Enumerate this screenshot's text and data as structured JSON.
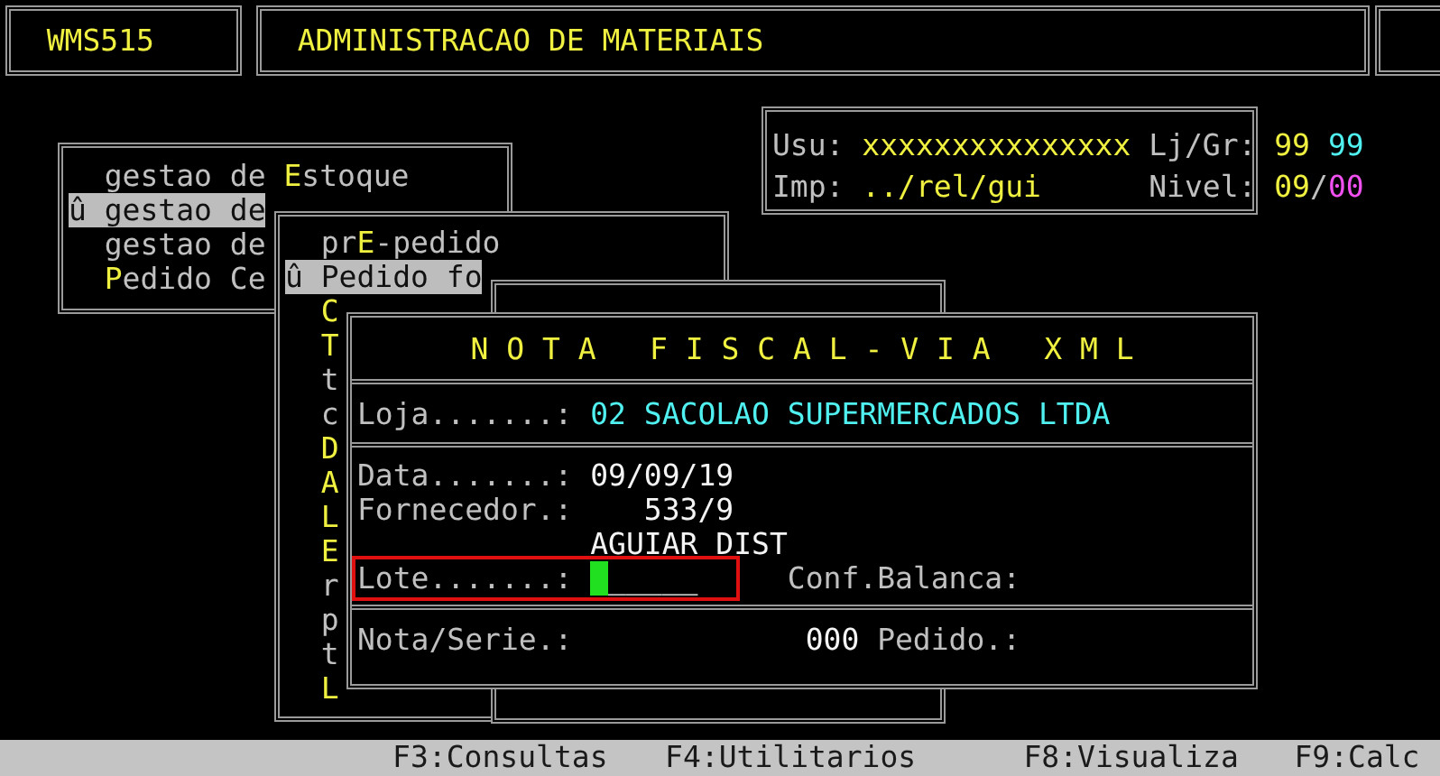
{
  "header": {
    "program_code": "WMS515",
    "title": "ADMINISTRACAO DE MATERIAIS"
  },
  "user_info": {
    "usu_label": "Usu:",
    "usu_value": "xxxxxxxxxxxxxxx",
    "lj_label": "Lj/Gr:",
    "loja": "99",
    "grupo": "99",
    "imp_label": "Imp:",
    "imp_value": "../rel/gui",
    "nivel_label": "Nivel:",
    "nivel": "09",
    "nivel_separator": "/",
    "nivel_sub": "00"
  },
  "main_menu": {
    "items": [
      {
        "selected": false,
        "parts": [
          {
            "text": "gestao de ",
            "hotkey": false
          },
          {
            "text": "E",
            "hotkey": true
          },
          {
            "text": "stoque",
            "hotkey": false
          }
        ]
      },
      {
        "selected": true,
        "marker": "û",
        "parts": [
          {
            "text": "gestao de",
            "hotkey": false
          }
        ]
      },
      {
        "selected": false,
        "parts": [
          {
            "text": "gestao de",
            "hotkey": false
          }
        ]
      },
      {
        "selected": false,
        "parts": [
          {
            "text": "P",
            "hotkey": true
          },
          {
            "text": "edido Ce",
            "hotkey": false
          }
        ]
      }
    ]
  },
  "sub_menu": {
    "items": [
      {
        "selected": false,
        "parts": [
          {
            "text": "pr",
            "hotkey": false
          },
          {
            "text": "E",
            "hotkey": true
          },
          {
            "text": "-pedido",
            "hotkey": false
          }
        ]
      },
      {
        "selected": true,
        "marker": "û",
        "parts": [
          {
            "text": "Pedido fo",
            "hotkey": false
          }
        ]
      },
      {
        "selected": false,
        "parts": [
          {
            "text": "C",
            "hotkey": true
          }
        ]
      },
      {
        "selected": false,
        "parts": [
          {
            "text": "T",
            "hotkey": true
          }
        ]
      },
      {
        "selected": false,
        "parts": [
          {
            "text": "t",
            "hotkey": false
          }
        ]
      },
      {
        "selected": false,
        "parts": [
          {
            "text": "c",
            "hotkey": false
          }
        ]
      },
      {
        "selected": false,
        "parts": [
          {
            "text": "D",
            "hotkey": true
          }
        ]
      },
      {
        "selected": false,
        "parts": [
          {
            "text": "A",
            "hotkey": true
          }
        ]
      },
      {
        "selected": false,
        "parts": [
          {
            "text": "L",
            "hotkey": true
          }
        ]
      },
      {
        "selected": false,
        "parts": [
          {
            "text": "E",
            "hotkey": true
          }
        ]
      },
      {
        "selected": false,
        "parts": [
          {
            "text": "r",
            "hotkey": false
          }
        ]
      },
      {
        "selected": false,
        "parts": [
          {
            "text": "p",
            "hotkey": false
          }
        ]
      },
      {
        "selected": false,
        "parts": [
          {
            "text": "t",
            "hotkey": false
          }
        ]
      },
      {
        "selected": false,
        "parts": [
          {
            "text": "L",
            "hotkey": true
          }
        ]
      }
    ]
  },
  "nota_fiscal": {
    "title": "N O T A   F I S C A L - V I A   X M L",
    "loja_label": "Loja.......:",
    "loja_value": "02 SACOLAO SUPERMERCADOS LTDA",
    "data_label": "Data.......:",
    "data_value": "09/09/19",
    "fornecedor_label": "Fornecedor.:",
    "fornecedor_code": "533/9",
    "fornecedor_name": "AGUIAR DIST",
    "lote_label": "Lote.......:",
    "lote_value": "_____",
    "conf_balanca_label": "Conf.Balanca:",
    "nota_serie_label": "Nota/Serie.:",
    "serie_value": "000",
    "pedido_label": "Pedido.:"
  },
  "status_bar": [
    "F3:Consultas",
    "F4:Utilitarios",
    "F8:Visualiza",
    "F9:Calc"
  ]
}
